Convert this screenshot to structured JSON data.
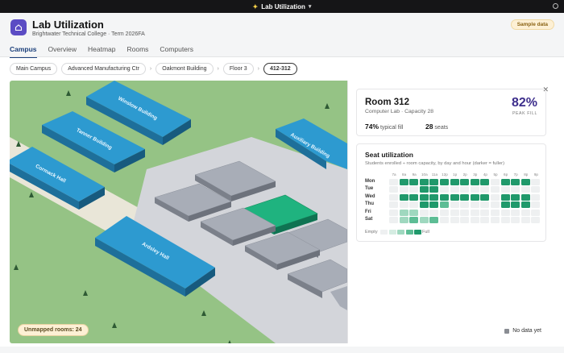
{
  "window": {
    "title": "Lab Utilization"
  },
  "header": {
    "title": "Lab Utilization",
    "subtitle": "Brightwater Technical College · Term 2026FA",
    "badge": "Sample data"
  },
  "tabs": [
    "Campus",
    "Overview",
    "Heatmap",
    "Rooms",
    "Computers"
  ],
  "breadcrumb": [
    "Main Campus",
    "Advanced Manufacturing Ctr",
    "Oakmont Building",
    "Floor 3",
    "412-312"
  ],
  "map": {
    "buildings": [
      "Winslow Building",
      "Tanner Building",
      "Cormack Hall",
      "Ardsley Hall",
      "Auxiliary Building"
    ],
    "unmapped": "Unmapped rooms: 24",
    "selected_room_color": "#1fb37f"
  },
  "room": {
    "name": "Room 312",
    "sub": "Computer Lab · Capacity 28",
    "peak_value": "82%",
    "peak_label": "PEAK FILL",
    "typical_value": "74%",
    "typical_label": "typical fill",
    "seats_value": "28",
    "seats_label": "seats"
  },
  "seat_utilization": {
    "title": "Seat utilization",
    "subtitle": "Students enrolled ÷ room capacity, by day and hour (darker = fuller)",
    "hours": [
      "7a",
      "8a",
      "9a",
      "10a",
      "11a",
      "12p",
      "1p",
      "2p",
      "3p",
      "4p",
      "5p",
      "6p",
      "7p",
      "8p",
      "9p"
    ],
    "days": [
      "Mon",
      "Tue",
      "Wed",
      "Thu",
      "Fri",
      "Sat"
    ],
    "levels": [
      [
        0,
        4,
        4,
        4,
        4,
        4,
        4,
        4,
        4,
        4,
        0,
        4,
        4,
        4,
        0
      ],
      [
        0,
        0,
        0,
        4,
        4,
        0,
        0,
        0,
        0,
        0,
        0,
        0,
        0,
        0,
        0
      ],
      [
        0,
        4,
        4,
        4,
        4,
        4,
        4,
        4,
        4,
        4,
        0,
        4,
        4,
        4,
        0
      ],
      [
        0,
        0,
        0,
        4,
        4,
        3,
        0,
        0,
        0,
        0,
        0,
        4,
        4,
        4,
        0
      ],
      [
        0,
        2,
        2,
        0,
        0,
        0,
        0,
        0,
        0,
        0,
        0,
        0,
        0,
        0,
        0
      ],
      [
        0,
        2,
        3,
        2,
        3,
        0,
        0,
        0,
        0,
        0,
        0,
        0,
        0,
        0,
        0
      ]
    ],
    "legend_empty": "Empty",
    "legend_full": "Full",
    "level_colors": [
      "#eef0f1",
      "#d5ece2",
      "#9fd8bf",
      "#5dbd95",
      "#20996b"
    ]
  },
  "no_data": "No data yet"
}
